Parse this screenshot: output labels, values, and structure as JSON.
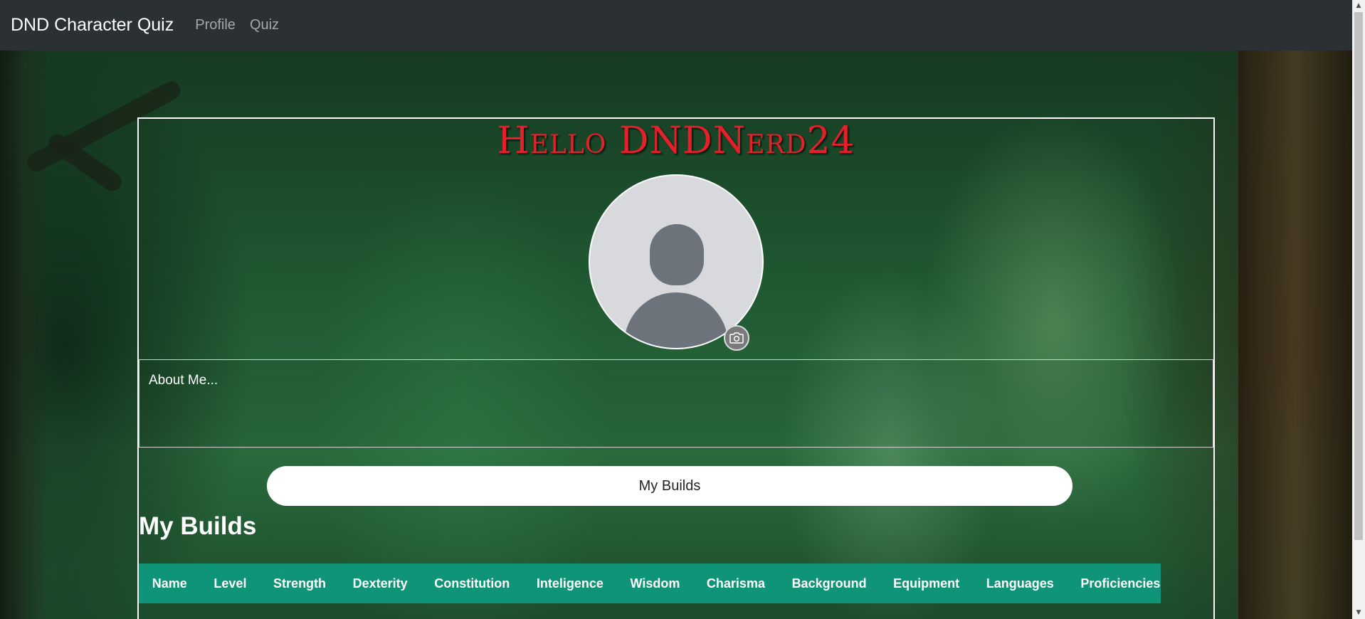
{
  "navbar": {
    "brand": "DND Character Quiz",
    "links": [
      "Profile",
      "Quiz"
    ]
  },
  "profile": {
    "greeting": "Hello DNDNerd24",
    "avatar_icon": "user-placeholder-icon",
    "camera_icon": "camera-icon",
    "about_placeholder": "About Me..."
  },
  "builds": {
    "button_label": "My Builds",
    "heading": "My Builds",
    "columns": [
      "Name",
      "Level",
      "Strength",
      "Dexterity",
      "Constitution",
      "Inteligence",
      "Wisdom",
      "Charisma",
      "Background",
      "Equipment",
      "Languages",
      "Proficiencies"
    ]
  },
  "colors": {
    "navbar_bg": "#2b3035",
    "greeting": "#e5202a",
    "table_header_bg": "#0f9477"
  }
}
